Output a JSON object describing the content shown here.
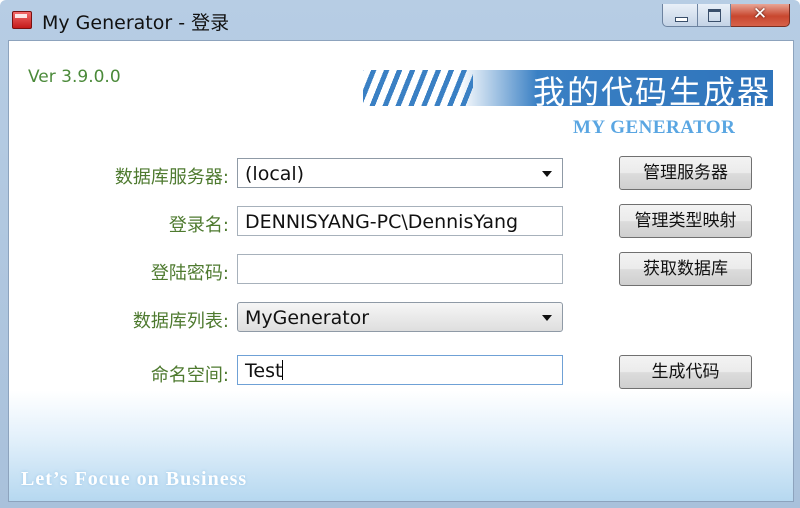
{
  "window": {
    "title": "My Generator - 登录",
    "close_glyph": "✕"
  },
  "version": "Ver 3.9.0.0",
  "banner": {
    "title": "我的代码生成器",
    "subtitle": "MY GENERATOR",
    "accent_color": "#3a80c4"
  },
  "form": {
    "server_label": "数据库服务器:",
    "server_value": "(local)",
    "login_label": "登录名:",
    "login_value": "DENNISYANG-PC\\DennisYang",
    "password_label": "登陆密码:",
    "password_value": "",
    "dblist_label": "数据库列表:",
    "dblist_value": "MyGenerator",
    "namespace_label": "命名空间:",
    "namespace_value": "Test"
  },
  "buttons": {
    "manage_servers": "管理服务器",
    "manage_type_mapping": "管理类型映射",
    "get_databases": "获取数据库",
    "generate_code": "生成代码"
  },
  "footer": "Let’s Focue on Business"
}
